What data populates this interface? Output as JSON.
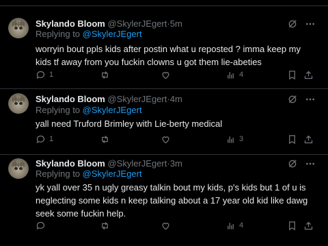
{
  "tweets": [
    {
      "name": "Skylando Bloom",
      "handle": "@SkylerJEgert",
      "separator": "·",
      "time": "5m",
      "replying_label": "Replying to",
      "replying_to": "@SkylerJEgert",
      "text": "worryin bout ppls kids after postin what u reposted ? imma keep my kids tf away from you fuckin clowns u got them lie-abeties",
      "replies": "1",
      "retweets": "",
      "likes": "",
      "views": "4"
    },
    {
      "name": "Skylando Bloom",
      "handle": "@SkylerJEgert",
      "separator": "·",
      "time": "4m",
      "replying_label": "Replying to",
      "replying_to": "@SkylerJEgert",
      "text": "yall need Truford Brimley with Lie-berty medical",
      "replies": "1",
      "retweets": "",
      "likes": "",
      "views": "3"
    },
    {
      "name": "Skylando Bloom",
      "handle": "@SkylerJEgert",
      "separator": "·",
      "time": "3m",
      "replying_label": "Replying to",
      "replying_to": "@SkylerJEgert",
      "text": "yk yall over 35 n ugly greasy talkin bout my kids, p's kids but 1 of u is neglecting some kids n keep talking about a 17 year old kid like dawg seek some fuckin help.",
      "replies": "",
      "retweets": "",
      "likes": "",
      "views": "4"
    }
  ],
  "colors": {
    "background": "#000000",
    "text": "#e7e9ea",
    "muted": "#71767b",
    "link": "#1d9bf0",
    "divider": "#2f3336"
  }
}
